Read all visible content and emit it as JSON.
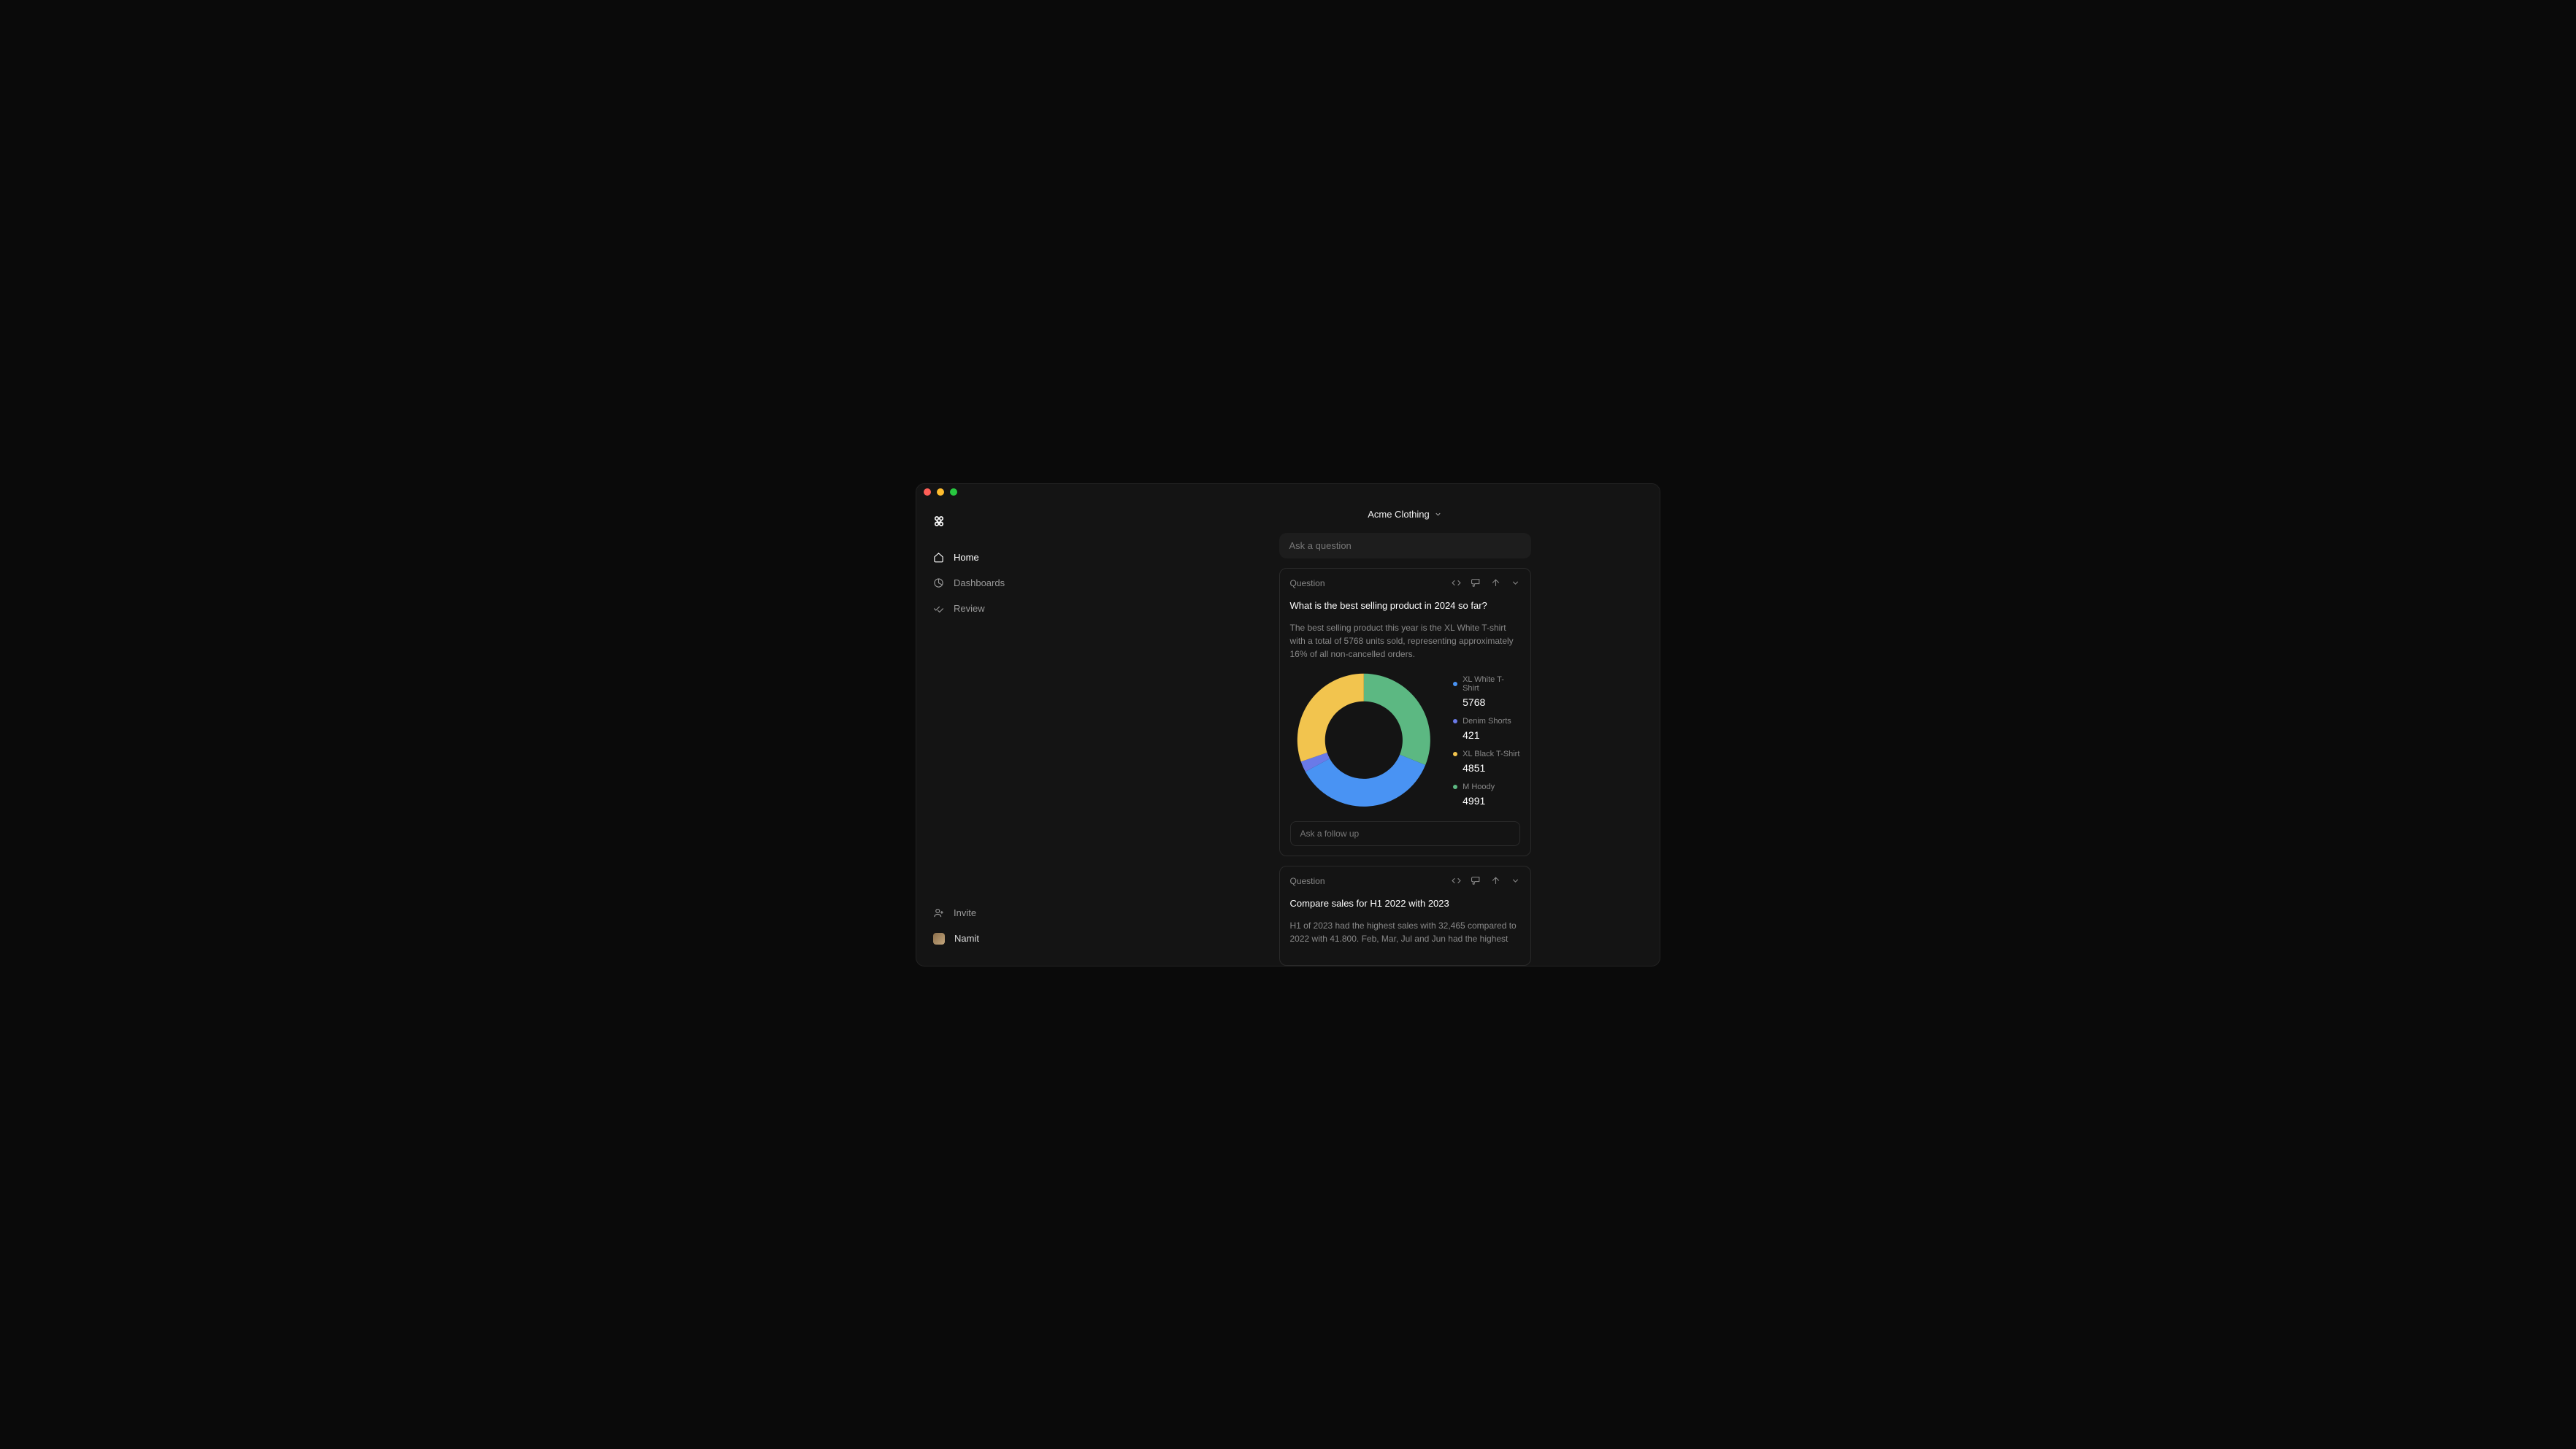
{
  "header": {
    "workspace": "Acme Clothing"
  },
  "sidebar": {
    "items": [
      {
        "label": "Home"
      },
      {
        "label": "Dashboards"
      },
      {
        "label": "Review"
      }
    ],
    "invite_label": "Invite",
    "user_name": "Namit"
  },
  "ask_placeholder": "Ask a question",
  "cards": [
    {
      "label": "Question",
      "title": "What is the best selling product in 2024 so far?",
      "body": "The best selling product this year is the XL White T-shirt with a total of 5768 units sold, representing approximately 16% of all non-cancelled orders.",
      "followup_placeholder": "Ask a follow up"
    },
    {
      "label": "Question",
      "title": "Compare sales for H1 2022 with 2023",
      "body": "H1 of 2023 had the highest sales with 32,465 compared to 2022 with 41.800. Feb, Mar, Jul and Jun had the highest"
    }
  ],
  "chart_data": {
    "type": "pie",
    "title": "",
    "series": [
      {
        "name": "XL White T-Shirt",
        "value": 5768,
        "color": "#4993f3"
      },
      {
        "name": "Denim Shorts",
        "value": 421,
        "color": "#6a7ae8"
      },
      {
        "name": "XL Black T-Shirt",
        "value": 4851,
        "color": "#f2c44e"
      },
      {
        "name": "M Hoody",
        "value": 4991,
        "color": "#5cb882"
      }
    ]
  }
}
